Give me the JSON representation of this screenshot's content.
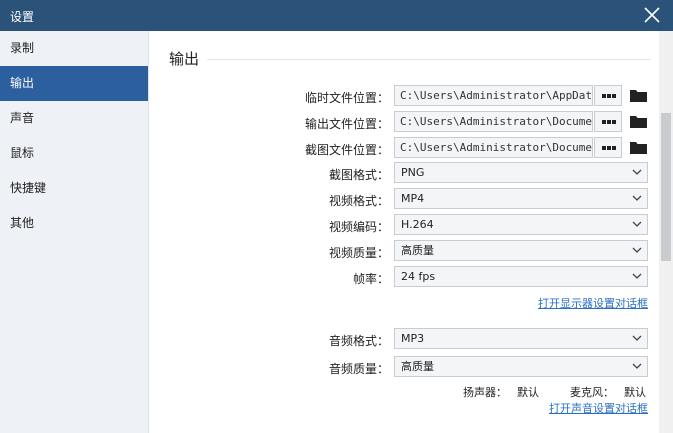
{
  "window": {
    "title": "设置"
  },
  "sidebar": {
    "items": [
      {
        "label": "录制"
      },
      {
        "label": "输出"
      },
      {
        "label": "声音"
      },
      {
        "label": "鼠标"
      },
      {
        "label": "快捷键"
      },
      {
        "label": "其他"
      }
    ],
    "active_index": 1
  },
  "output": {
    "section_title": "输出",
    "temp_path": {
      "label": "临时文件位置：",
      "value": "C:\\Users\\Administrator\\AppData\\L"
    },
    "output_path": {
      "label": "输出文件位置：",
      "value": "C:\\Users\\Administrator\\Documents"
    },
    "screenshot_path": {
      "label": "截图文件位置：",
      "value": "C:\\Users\\Administrator\\Documents"
    },
    "screenshot_format": {
      "label": "截图格式：",
      "value": "PNG"
    },
    "video_format": {
      "label": "视频格式：",
      "value": "MP4"
    },
    "video_codec": {
      "label": "视频编码：",
      "value": "H.264"
    },
    "video_quality": {
      "label": "视频质量：",
      "value": "高质量"
    },
    "frame_rate": {
      "label": "帧率：",
      "value": "24 fps"
    },
    "display_settings_link": "打开显示器设置对话框",
    "audio_format": {
      "label": "音频格式：",
      "value": "MP3"
    },
    "audio_quality": {
      "label": "音频质量：",
      "value": "高质量"
    },
    "speaker": {
      "label": "扬声器：",
      "value": "默认"
    },
    "microphone": {
      "label": "麦克风：",
      "value": "默认"
    },
    "sound_settings_link": "打开声音设置对话框"
  },
  "colors": {
    "titlebar": "#2b5278",
    "active_item": "#2b5f9e",
    "link": "#2a6fc4"
  }
}
